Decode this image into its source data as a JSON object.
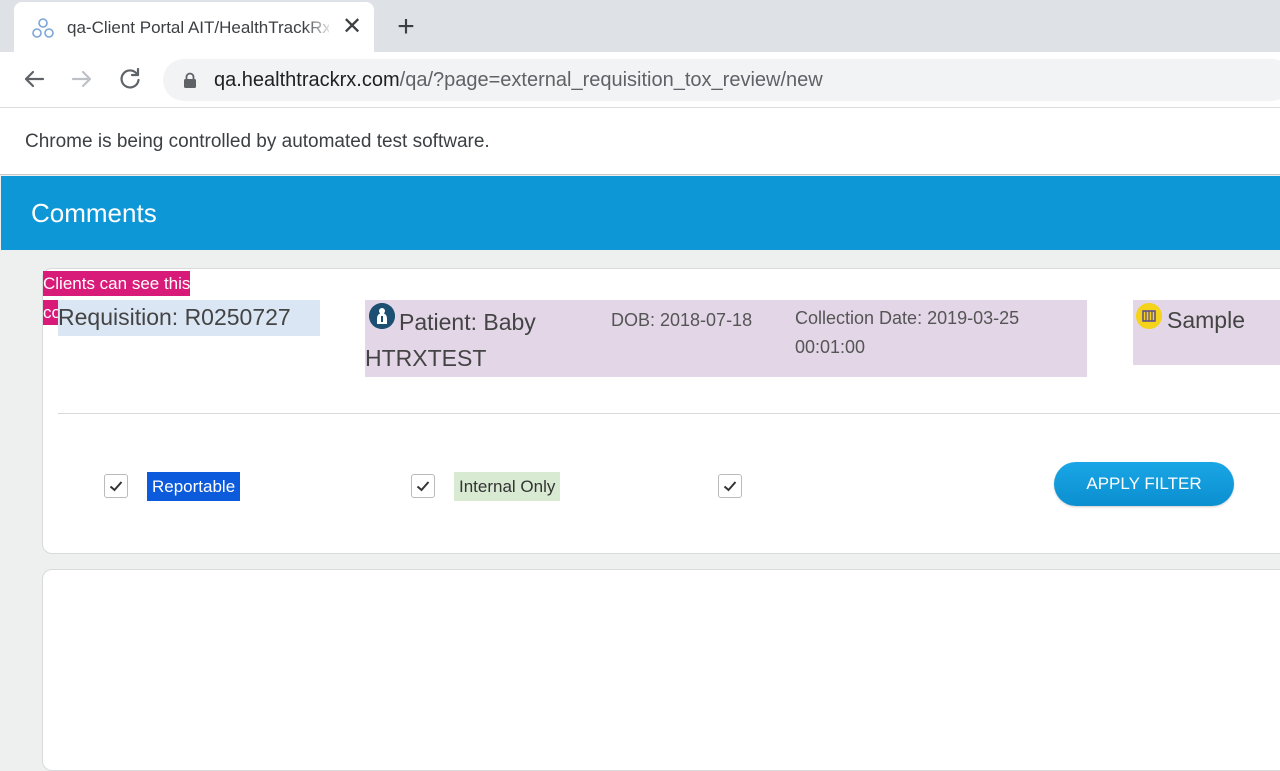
{
  "browser": {
    "tab_title": "qa-Client Portal AIT/HealthTrackRx",
    "url_host": "qa.healthtrackrx.com",
    "url_path": "/qa/?page=external_requisition_tox_review/new",
    "infobar_text": "Chrome is being controlled by automated test software.",
    "close_glyph": "✕",
    "newtab_glyph": "+"
  },
  "page": {
    "title": "Comments"
  },
  "requisition": {
    "label": "Requisition: R0250727"
  },
  "patient": {
    "name": "Patient: Baby HTRXTEST",
    "dob": "DOB: 2018-07-18",
    "collection": "Collection Date: 2019-03-25 00:01:00"
  },
  "sample": {
    "label": "Sample"
  },
  "filters": {
    "reportable": {
      "label": "Reportable",
      "checked": true
    },
    "internal": {
      "label": "Internal Only",
      "checked": true
    },
    "clients": {
      "label": "Clients can see this comment",
      "checked": true
    },
    "apply_label": "APPLY FILTER"
  },
  "colors": {
    "header": "#0e97d6",
    "reportable": "#0b5bdc",
    "internal": "#d9ead3",
    "clients": "#d81b79",
    "patient_bg": "#e2d6e7",
    "requisition_bg": "#dbe6f5"
  }
}
